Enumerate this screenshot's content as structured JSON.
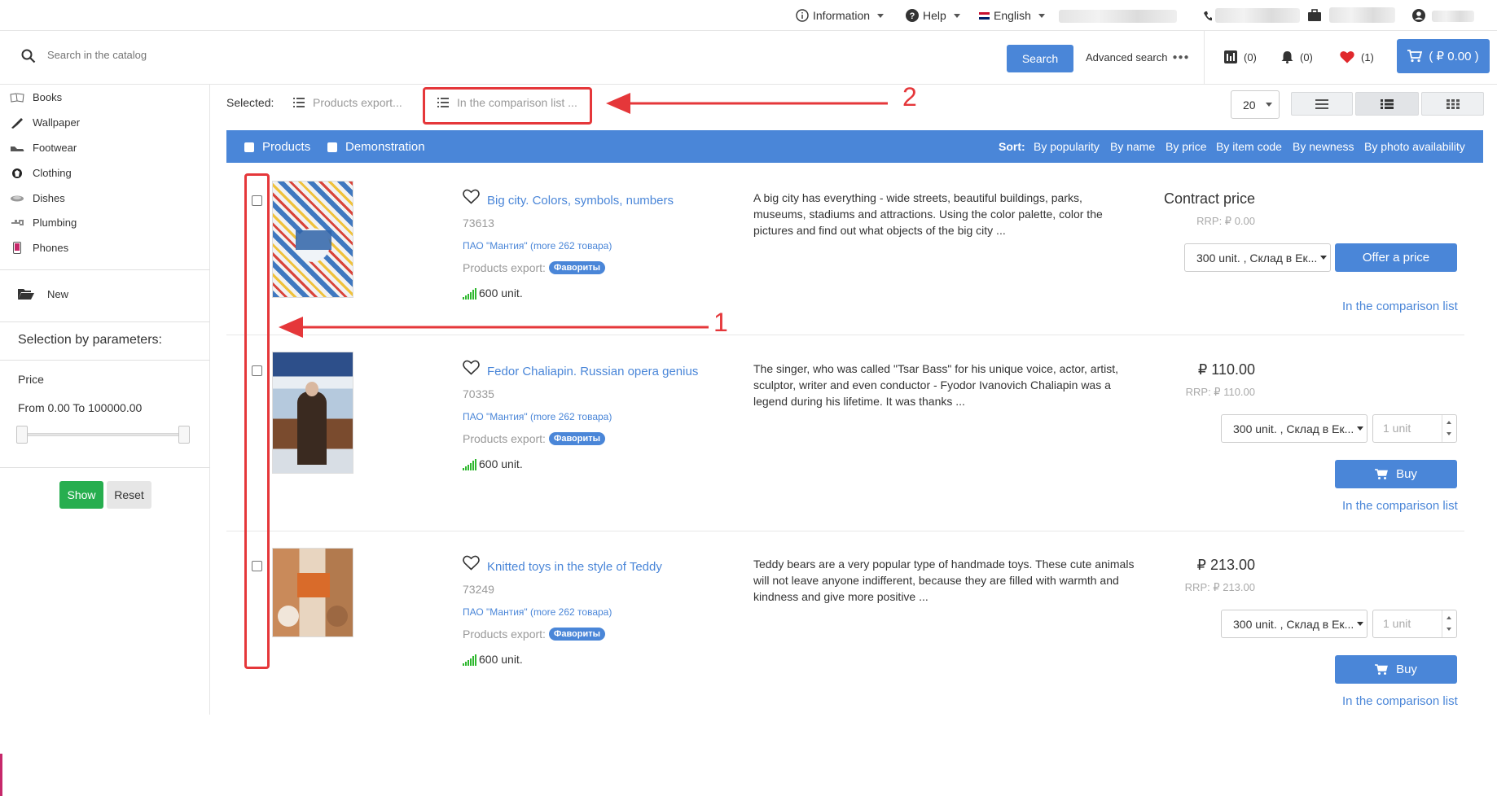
{
  "topbar": {
    "information": "Information",
    "help": "Help",
    "language": "English"
  },
  "search": {
    "placeholder": "Search in the catalog",
    "button": "Search",
    "advanced": "Advanced search"
  },
  "header_counters": {
    "compare": "(0)",
    "notifications": "(0)",
    "favorites": "(1)",
    "cart": "( ₽ 0.00 )"
  },
  "sidebar": {
    "categories": [
      {
        "label": "Books",
        "icon": "book-icon"
      },
      {
        "label": "Wallpaper",
        "icon": "brush-icon"
      },
      {
        "label": "Footwear",
        "icon": "shoe-icon"
      },
      {
        "label": "Clothing",
        "icon": "shirt-icon"
      },
      {
        "label": "Dishes",
        "icon": "dish-icon"
      },
      {
        "label": "Plumbing",
        "icon": "faucet-icon"
      },
      {
        "label": "Phones",
        "icon": "phone-icon"
      }
    ],
    "new_label": "New",
    "selection_title": "Selection by parameters:",
    "price_label": "Price",
    "price_range_text": "From 0.00 To 100000.00",
    "show_button": "Show",
    "reset_button": "Reset"
  },
  "toolbar": {
    "selected_label": "Selected:",
    "products_export": "Products export...",
    "comparison_list": "In the comparison list ...",
    "per_page": "20"
  },
  "listbar": {
    "products_label": "Products",
    "demonstration_label": "Demonstration",
    "sort_label": "Sort:",
    "sort_options": [
      "By popularity",
      "By name",
      "By price",
      "By item code",
      "By newness",
      "By photo availability"
    ]
  },
  "products": [
    {
      "title": "Big city. Colors, symbols, numbers",
      "code": "73613",
      "vendor": "ПАО \"Мантия\" (more 262 товара)",
      "export_label": "Products export:",
      "export_badge": "Фавориты",
      "stock": "600 unit.",
      "description": "A big city has everything - wide streets, beautiful buildings, parks, museums, stadiums and attractions. Using the color palette, color the pictures and find out what objects of the big city ...",
      "price": "Contract price",
      "rrp": "RRP: ₽ 0.00",
      "warehouse": "300 unit. , Склад в Ек...",
      "action": "Offer a price",
      "compare": "In the comparison list"
    },
    {
      "title": "Fedor Chaliapin. Russian opera genius",
      "code": "70335",
      "vendor": "ПАО \"Мантия\" (more 262 товара)",
      "export_label": "Products export:",
      "export_badge": "Фавориты",
      "stock": "600 unit.",
      "description": "The singer, who was called \"Tsar Bass\" for his unique voice, actor, artist, sculptor, writer and even conductor - Fyodor Ivanovich Chaliapin was a legend during his lifetime. It was thanks ...",
      "price": "₽ 110.00",
      "rrp": "RRP: ₽ 110.00",
      "warehouse": "300 unit. , Склад в Ек...",
      "qty_placeholder": "1 unit",
      "action": "Buy",
      "compare": "In the comparison list"
    },
    {
      "title": "Knitted toys in the style of Teddy",
      "code": "73249",
      "vendor": "ПАО \"Мантия\" (more 262 товара)",
      "export_label": "Products export:",
      "export_badge": "Фавориты",
      "stock": "600 unit.",
      "description": "Teddy bears are a very popular type of handmade toys. These cute animals will not leave anyone indifferent, because they are filled with warmth and kindness and give more positive ...",
      "price": "₽ 213.00",
      "rrp": "RRP: ₽ 213.00",
      "warehouse": "300 unit. , Склад в Ек...",
      "qty_placeholder": "1 unit",
      "action": "Buy",
      "compare": "In the comparison list"
    }
  ],
  "annotations": {
    "label_1": "1",
    "label_2": "2"
  },
  "colors": {
    "accent": "#4a86d8",
    "annotation": "#e5373a",
    "show_button": "#27ae4f",
    "stock_green": "#2eb82e"
  }
}
